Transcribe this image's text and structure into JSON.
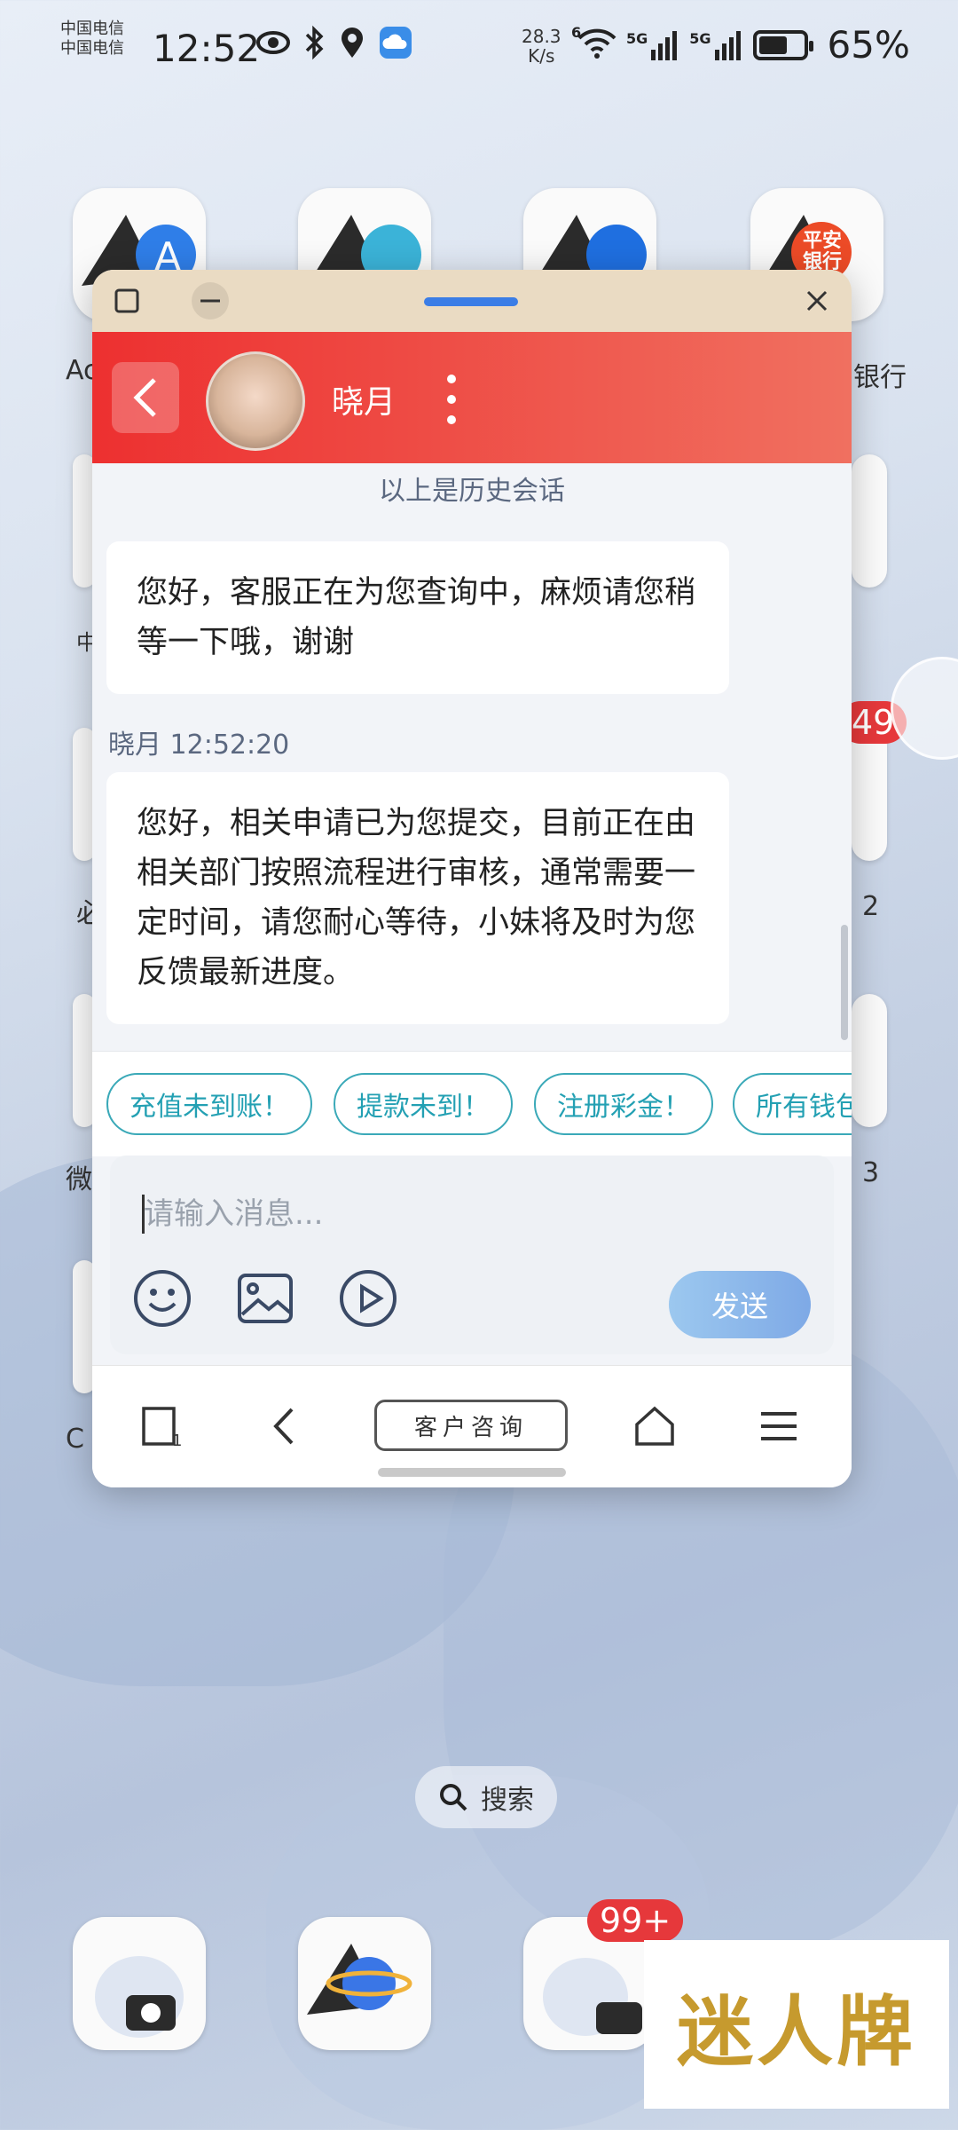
{
  "status_bar": {
    "carrier_1": "中国电信",
    "carrier_2": "中国电信",
    "time": "12:52",
    "net_speed_value": "28.3",
    "net_speed_unit": "K/s",
    "wifi_tag": "6",
    "sim1_tag": "5G",
    "sim2_tag": "5G",
    "battery_percent": "65%",
    "battery_level": 0.65
  },
  "home_screen": {
    "labels": {
      "left_top": "Ac",
      "right_top": "银行",
      "left_mid": "中",
      "left_mid2": "必",
      "right_mid": "2",
      "left_low": "微",
      "right_low": "3",
      "left_bottom": "C"
    },
    "badges": {
      "right_mid_badge": "49",
      "dock_badge": "99+"
    },
    "bank_icon_text": "平安银行",
    "search_label": "搜索"
  },
  "floating_window": {
    "chat": {
      "agent_name": "晓月",
      "history_divider": "以上是历史会话",
      "messages": [
        {
          "text": "您好，客服正在为您查询中，麻烦请您稍等一下哦，谢谢"
        },
        {
          "sender_time": "晓月 12:52:20",
          "text": "您好，相关申请已为您提交，目前正在由相关部门按照流程进行审核，通常需要一定时间，请您耐心等待，小妹将及时为您反馈最新进度。"
        }
      ]
    },
    "quick_replies": [
      "充值未到账！",
      "提款未到！",
      "注册彩金！",
      "所有钱包"
    ],
    "input": {
      "placeholder": "请输入消息...",
      "send_label": "发送"
    },
    "browser_bar": {
      "tab_count": "1",
      "center_label": "客户咨询"
    }
  },
  "watermark_text": "迷人牌",
  "colors": {
    "header_red": "#ed3030",
    "chip_teal": "#23a0b3",
    "send_blue": "#7ea9e6",
    "badge_red": "#e6383b"
  }
}
